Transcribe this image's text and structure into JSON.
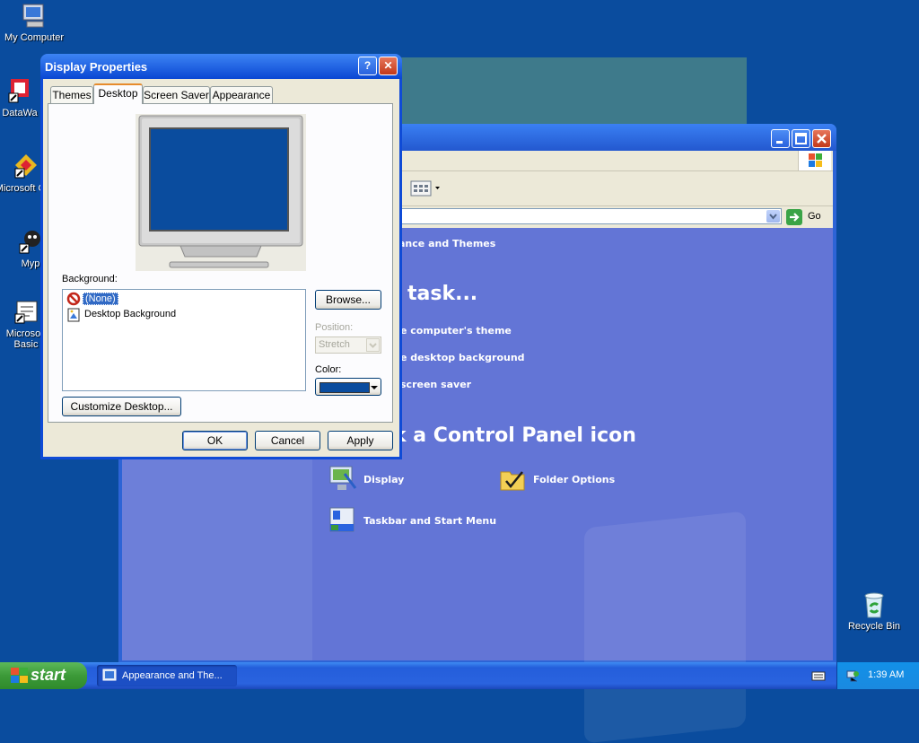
{
  "desktop": {
    "icons": [
      {
        "label": "My Computer",
        "icon": "my-computer-icon"
      },
      {
        "label": "DataWa",
        "icon": "shortcut-icon"
      },
      {
        "label": "Microsoft C++",
        "icon": "shortcut-icon"
      },
      {
        "label": "Myp",
        "icon": "shortcut-icon"
      },
      {
        "label": "Microsoft Basic",
        "icon": "shortcut-icon"
      },
      {
        "label": "Recycle Bin",
        "icon": "recycle-bin-icon"
      }
    ],
    "background_color": "#0a4c9e"
  },
  "control_panel": {
    "address_text": "ance and Themes",
    "go_label": "Go",
    "heading_task": "task...",
    "tasks": [
      "e computer's theme",
      "e desktop background",
      "screen saver"
    ],
    "heading_icon": "k a Control Panel icon",
    "icons": [
      {
        "label": "Display",
        "icon": "display-icon"
      },
      {
        "label": "Folder Options",
        "icon": "folder-options-icon"
      },
      {
        "label": "Taskbar and Start Menu",
        "icon": "taskbar-icon"
      }
    ]
  },
  "dialog": {
    "title": "Display Properties",
    "help_glyph": "?",
    "close_glyph": "✕",
    "tabs": [
      "Themes",
      "Desktop",
      "Screen Saver",
      "Appearance"
    ],
    "selected_tab": "Desktop",
    "background_label": "Background:",
    "background_items": [
      "(None)",
      "Desktop Background"
    ],
    "selected_background": "(None)",
    "browse_label": "Browse...",
    "position_label": "Position:",
    "position_value": "Stretch",
    "color_label": "Color:",
    "color_value": "#0a4c9e",
    "customize_label": "Customize Desktop...",
    "ok_label": "OK",
    "cancel_label": "Cancel",
    "apply_label": "Apply"
  },
  "taskbar": {
    "start_label": "start",
    "task_item": "Appearance and The...",
    "clock": "1:39 AM"
  }
}
